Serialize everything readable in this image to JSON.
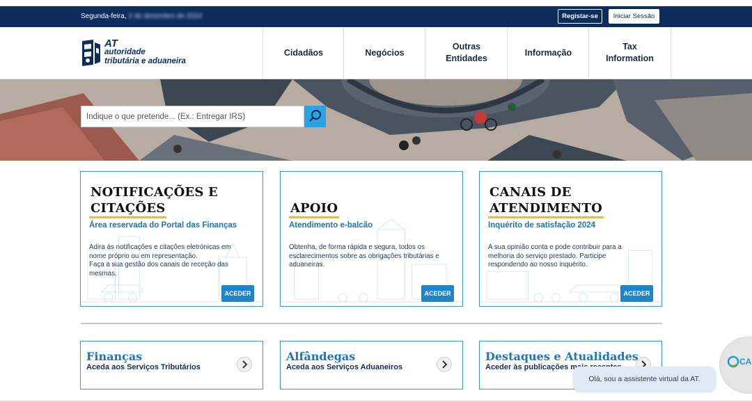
{
  "topbar": {
    "date_prefix": "Segunda-feira,",
    "date_rest": "2 de dezembro de 2024",
    "register_label": "Registar-se",
    "login_label": "Iniciar Sessão"
  },
  "logo": {
    "abbr": "AT",
    "line1": "autoridade",
    "line2": "tributária e aduaneira"
  },
  "nav": [
    {
      "line1": "Cidadãos",
      "line2": ""
    },
    {
      "line1": "Negócios",
      "line2": ""
    },
    {
      "line1": "Outras",
      "line2": "Entidades"
    },
    {
      "line1": "Informação",
      "line2": ""
    },
    {
      "line1": "Tax",
      "line2": "Information"
    }
  ],
  "search": {
    "placeholder": "Indique o que pretende... (Ex.: Entregar IRS)"
  },
  "cards": [
    {
      "title1": "NOTIFICAÇÕES E",
      "title2": "CITAÇÕES",
      "subtitle": "Área reservada do Portal das Finanças",
      "desc1": "Adira às notificações e citações eletrónicas em nome próprio ou em representação.",
      "desc2": "Faça a sua gestão dos canais de receção das mesmas.",
      "button": "ACEDER"
    },
    {
      "title1": "",
      "title2": "APOIO",
      "subtitle": "Atendimento e-balcão",
      "desc1": "Obtenha, de forma rápida e segura, todos os esclarecimentos sobre as obrigações tributárias e aduaneiras.",
      "desc2": "",
      "button": "ACEDER"
    },
    {
      "title1": "CANAIS DE",
      "title2": "ATENDIMENTO",
      "subtitle": "Inquérito de satisfação 2024",
      "desc1": "A sua opinião conta e pode contribuir para a melhoria do serviço prestado. Participe respondendo ao nosso inquérito.",
      "desc2": "",
      "button": "ACEDER"
    }
  ],
  "services": [
    {
      "title": "Finanças",
      "subtitle": "Aceda aos Serviços Tributários"
    },
    {
      "title": "Alfândegas",
      "subtitle": "Aceda aos Serviços Aduaneiros"
    },
    {
      "title": "Destaques e Atualidades",
      "subtitle": "Aceder às publicações mais recentes"
    }
  ],
  "assistant": {
    "message": "Olá, sou a assistente virtual da AT.",
    "label": "CA"
  },
  "colors": {
    "topbar": "#0d2c5e",
    "accent_blue": "#1f85c9",
    "search_button": "#2aa3e0",
    "title_underline": "#f2c300"
  }
}
